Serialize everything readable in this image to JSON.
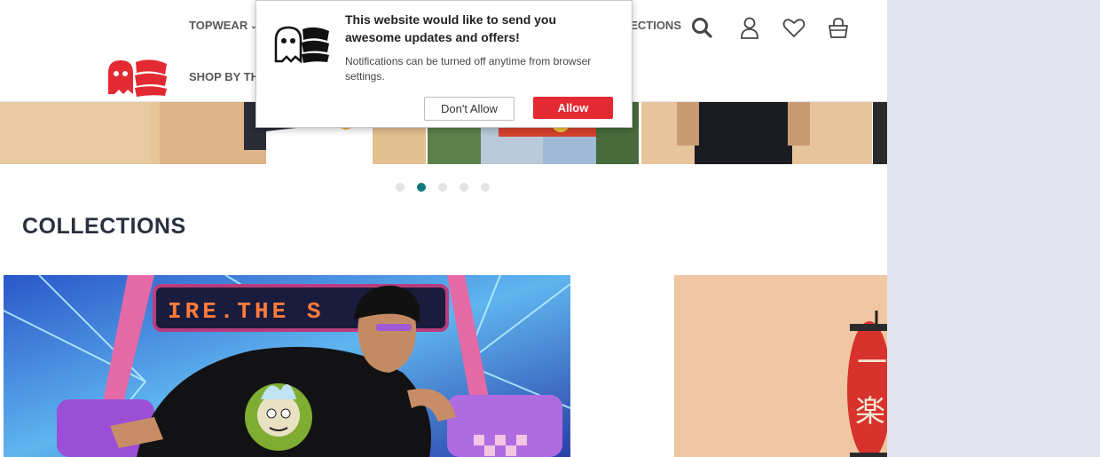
{
  "header": {
    "logo_alt": "The Souled Store",
    "nav_topwear": "TOPWEAR",
    "nav_shop_by": "SHOP BY THEME",
    "nav_collections": "COLLECTIONS",
    "icons": [
      "search-icon",
      "user-icon",
      "heart-icon",
      "bag-icon"
    ]
  },
  "carousel": {
    "slide_count": 5,
    "active_index": 1
  },
  "collections": {
    "title": "COLLECTIONS"
  },
  "notification": {
    "title": "This website would like to send you awesome updates and offers!",
    "body": "Notifications can be turned off anytime from browser settings.",
    "deny_label": "Don't Allow",
    "allow_label": "Allow"
  },
  "colors": {
    "brand_red": "#e32931",
    "active_dot": "#117a7a",
    "title_text": "#2c2f3f",
    "side_background": "#e1e3ec"
  }
}
